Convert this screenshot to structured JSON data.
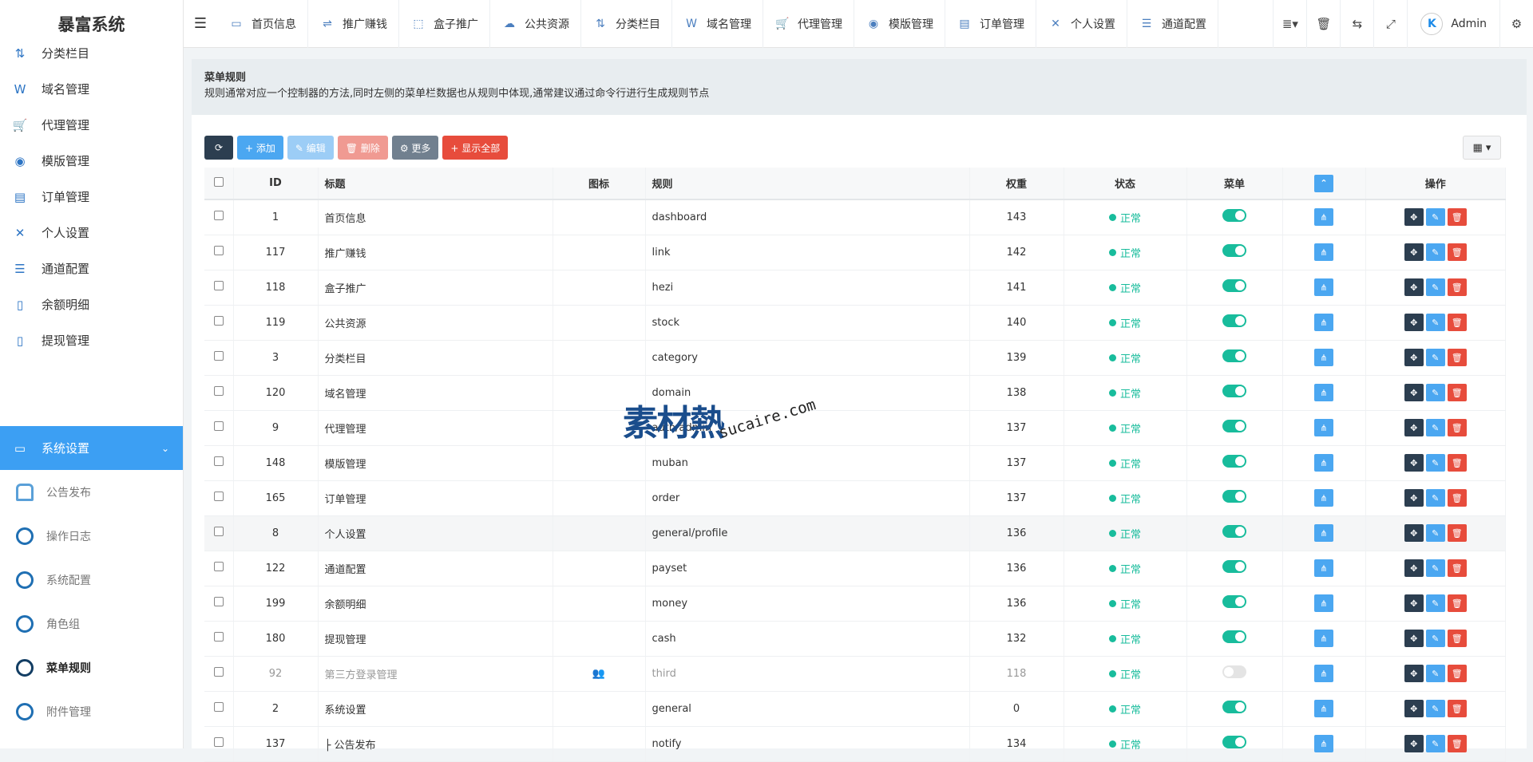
{
  "app": {
    "title": "暴富系统"
  },
  "topnav": [
    {
      "label": "首页信息",
      "icon": "dashboard-icon"
    },
    {
      "label": "推广赚钱",
      "icon": "link-icon"
    },
    {
      "label": "盒子推广",
      "icon": "box-icon"
    },
    {
      "label": "公共资源",
      "icon": "stock-icon"
    },
    {
      "label": "分类栏目",
      "icon": "category-icon"
    },
    {
      "label": "域名管理",
      "icon": "domain-icon"
    },
    {
      "label": "代理管理",
      "icon": "cart-icon"
    },
    {
      "label": "模版管理",
      "icon": "template-icon"
    },
    {
      "label": "订单管理",
      "icon": "order-icon"
    },
    {
      "label": "个人设置",
      "icon": "profile-icon"
    },
    {
      "label": "通道配置",
      "icon": "payset-icon"
    }
  ],
  "user": {
    "name": "Admin",
    "avatar": "K"
  },
  "sidebar": {
    "items": [
      {
        "label": "分类栏目"
      },
      {
        "label": "域名管理"
      },
      {
        "label": "代理管理"
      },
      {
        "label": "模版管理"
      },
      {
        "label": "订单管理"
      },
      {
        "label": "个人设置"
      },
      {
        "label": "通道配置"
      },
      {
        "label": "余额明细"
      },
      {
        "label": "提现管理"
      }
    ],
    "active": {
      "label": "系统设置"
    },
    "subitems": [
      {
        "label": "公告发布"
      },
      {
        "label": "操作日志"
      },
      {
        "label": "系统配置"
      },
      {
        "label": "角色组"
      },
      {
        "label": "菜单规则"
      },
      {
        "label": "附件管理"
      }
    ]
  },
  "page": {
    "title": "菜单规则",
    "desc": "规则通常对应一个控制器的方法,同时左侧的菜单栏数据也从规则中体现,通常建议通过命令行进行生成规则节点"
  },
  "toolbar": {
    "refresh": "⟳",
    "add": "+ 添加",
    "edit": "✎ 编辑",
    "del": "🗑 删除",
    "more": "⚙ 更多",
    "showall": "+ 显示全部"
  },
  "table": {
    "headers": {
      "id": "ID",
      "title": "标题",
      "icon": "图标",
      "rule": "规则",
      "weigh": "权重",
      "status": "状态",
      "menu": "菜单",
      "op": "操作"
    },
    "rows": [
      {
        "id": "1",
        "title": "首页信息",
        "rule": "dashboard",
        "weigh": "143",
        "status": "正常",
        "menu": true
      },
      {
        "id": "117",
        "title": "推广赚钱",
        "rule": "link",
        "weigh": "142",
        "status": "正常",
        "menu": true
      },
      {
        "id": "118",
        "title": "盒子推广",
        "rule": "hezi",
        "weigh": "141",
        "status": "正常",
        "menu": true
      },
      {
        "id": "119",
        "title": "公共资源",
        "rule": "stock",
        "weigh": "140",
        "status": "正常",
        "menu": true
      },
      {
        "id": "3",
        "title": "分类栏目",
        "rule": "category",
        "weigh": "139",
        "status": "正常",
        "menu": true
      },
      {
        "id": "120",
        "title": "域名管理",
        "rule": "domain",
        "weigh": "138",
        "status": "正常",
        "menu": true
      },
      {
        "id": "9",
        "title": "代理管理",
        "rule": "auth/admin",
        "weigh": "137",
        "status": "正常",
        "menu": true
      },
      {
        "id": "148",
        "title": "模版管理",
        "rule": "muban",
        "weigh": "137",
        "status": "正常",
        "menu": true
      },
      {
        "id": "165",
        "title": "订单管理",
        "rule": "order",
        "weigh": "137",
        "status": "正常",
        "menu": true
      },
      {
        "id": "8",
        "title": "个人设置",
        "rule": "general/profile",
        "weigh": "136",
        "status": "正常",
        "menu": true
      },
      {
        "id": "122",
        "title": "通道配置",
        "rule": "payset",
        "weigh": "136",
        "status": "正常",
        "menu": true
      },
      {
        "id": "199",
        "title": "余额明细",
        "rule": "money",
        "weigh": "136",
        "status": "正常",
        "menu": true
      },
      {
        "id": "180",
        "title": "提现管理",
        "rule": "cash",
        "weigh": "132",
        "status": "正常",
        "menu": true
      },
      {
        "id": "92",
        "title": "第三方登录管理",
        "rule": "third",
        "weigh": "118",
        "status": "正常",
        "menu": false,
        "icon": "users-icon"
      },
      {
        "id": "2",
        "title": "系统设置",
        "rule": "general",
        "weigh": "0",
        "status": "正常",
        "menu": true
      },
      {
        "id": "137",
        "title": "├ 公告发布",
        "rule": "notify",
        "weigh": "134",
        "status": "正常",
        "menu": true
      }
    ]
  },
  "watermark": {
    "text1": "素材熱",
    "text2": "sucaire.com"
  }
}
